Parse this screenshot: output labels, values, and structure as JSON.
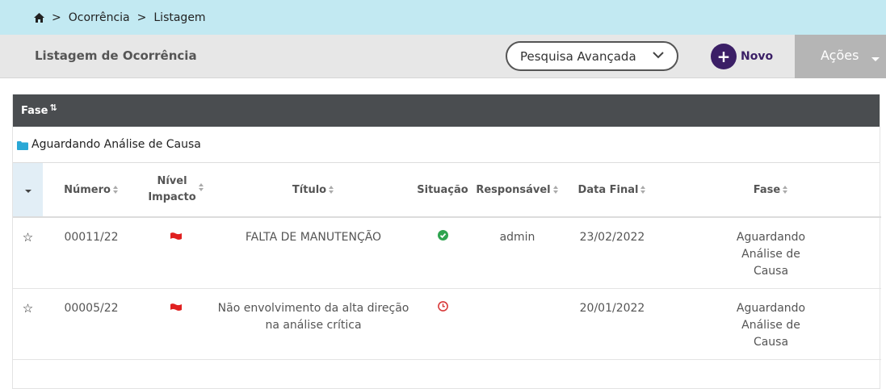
{
  "breadcrumb": {
    "items": [
      "Ocorrência",
      "Listagem"
    ],
    "separator": ">"
  },
  "toolbar": {
    "title": "Listagem de Ocorrência",
    "search_label": "Pesquisa Avançada",
    "new_label": "Novo",
    "actions_label": "Ações"
  },
  "grid": {
    "group_column": "Fase",
    "group_name": "Aguardando Análise de Causa",
    "columns": {
      "numero": "Número",
      "nivel_1": "Nível",
      "nivel_2": "Impacto",
      "titulo": "Título",
      "situacao": "Situação",
      "responsavel": "Responsável",
      "data_final": "Data Final",
      "fase": "Fase"
    },
    "rows": [
      {
        "numero": "00011/22",
        "impact_color": "#e02020",
        "titulo": "FALTA DE MANUTENÇÃO",
        "situacao": "check-circle-icon",
        "responsavel": "admin",
        "data_final": "23/02/2022",
        "fase_1": "Aguardando",
        "fase_2": "Análise de",
        "fase_3": "Causa"
      },
      {
        "numero": "00005/22",
        "impact_color": "#e02020",
        "titulo": "Não envolvimento da alta direção na análise crítica",
        "situacao": "clock-icon",
        "responsavel": "",
        "data_final": "20/01/2022",
        "fase_1": "Aguardando",
        "fase_2": "Análise de",
        "fase_3": "Causa"
      }
    ]
  },
  "colors": {
    "header_bg": "#c2e9f2",
    "novo": "#3b1f66",
    "ok": "#2ea44f",
    "late": "#d83a3a",
    "folder": "#2aa8d6"
  }
}
